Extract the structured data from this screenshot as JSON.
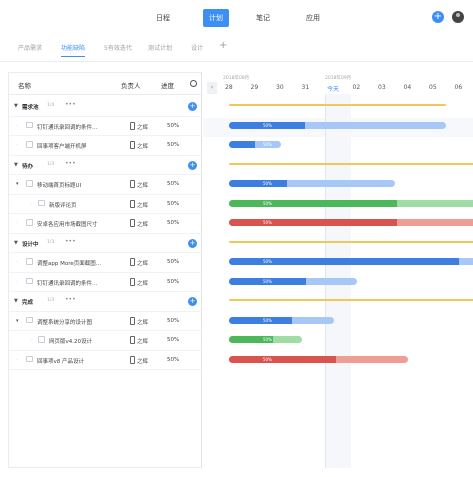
{
  "topnav": {
    "items": [
      {
        "label": "日程",
        "active": false
      },
      {
        "label": "计划",
        "active": true
      },
      {
        "label": "笔记",
        "active": false
      },
      {
        "label": "应用",
        "active": false
      }
    ],
    "add_label": "+"
  },
  "tabs": [
    {
      "label": "产品需求",
      "active": false
    },
    {
      "label": "功能缺陷",
      "active": true
    },
    {
      "label": "5有效迭代",
      "active": false
    },
    {
      "label": "测试计划",
      "active": false
    },
    {
      "label": "设计",
      "active": false
    }
  ],
  "tab_add": "+",
  "table": {
    "headers": {
      "name": "名称",
      "owner": "负责人",
      "progress": "进度"
    },
    "rows": [
      {
        "type": "group",
        "name": "需求池",
        "count": "1/4",
        "more": "•••"
      },
      {
        "type": "task",
        "name": "钉钉通讯录回调的条件...",
        "owner": "之辉",
        "progress": "50%"
      },
      {
        "type": "task",
        "name": "回事项客户端开机屏",
        "owner": "之辉",
        "progress": "50%"
      },
      {
        "type": "group",
        "name": "待办",
        "count": "1/3",
        "more": "•••"
      },
      {
        "type": "task",
        "name": "移动端首页标题UI",
        "owner": "之辉",
        "progress": "50%",
        "expand": true
      },
      {
        "type": "subtask",
        "name": "新版评论页",
        "owner": "之辉",
        "progress": "50%"
      },
      {
        "type": "task",
        "name": "安卓各应用市场截图尺寸",
        "owner": "之辉",
        "progress": "50%"
      },
      {
        "type": "group",
        "name": "设计中",
        "count": "1/3",
        "more": "•••"
      },
      {
        "type": "task",
        "name": "调整app More页面截图...",
        "owner": "之辉",
        "progress": "50%"
      },
      {
        "type": "task",
        "name": "钉钉通讯录回调的条件...",
        "owner": "之辉",
        "progress": "50%"
      },
      {
        "type": "group",
        "name": "完成",
        "count": "1/3",
        "more": "•••"
      },
      {
        "type": "task",
        "name": "调整系统分享的设计图",
        "owner": "之辉",
        "progress": "50%",
        "expand": true
      },
      {
        "type": "subtask",
        "name": "网页版v4.20设计",
        "owner": "之辉",
        "progress": "50%"
      },
      {
        "type": "task",
        "name": "回事项v8 产品设计",
        "owner": "之辉",
        "progress": "50%"
      }
    ]
  },
  "gantt": {
    "months": [
      {
        "label": "2018年08月",
        "day_index": 0
      },
      {
        "label": "2018年09月",
        "day_index": 4
      }
    ],
    "days": [
      "28",
      "29",
      "30",
      "31",
      "今天",
      "02",
      "03",
      "04",
      "05",
      "06"
    ],
    "today_index": 4,
    "bars": [
      {
        "row": 0,
        "kind": "group",
        "start": 0.0,
        "end": 8.5,
        "color": "#f1c75a"
      },
      {
        "row": 1,
        "kind": "task",
        "start": 0.0,
        "end": 8.5,
        "progress": 0.35,
        "color": "#3d7fe0",
        "light": "#a7c8f6",
        "pct": "50%"
      },
      {
        "row": 2,
        "kind": "task",
        "start": 0.0,
        "end": 2.05,
        "progress": 0.5,
        "color": "#3d7fe0",
        "light": "#a7c8f6",
        "pct": "50%"
      },
      {
        "row": 3,
        "kind": "group",
        "start": 0.0,
        "end": 10.0,
        "color": "#f1c75a"
      },
      {
        "row": 4,
        "kind": "task",
        "start": 0.0,
        "end": 6.5,
        "progress": 0.35,
        "color": "#3d7fe0",
        "light": "#a7c8f6",
        "pct": "50%"
      },
      {
        "row": 5,
        "kind": "task",
        "start": 0.0,
        "end": 10.0,
        "progress": 0.66,
        "color": "#4cb85b",
        "light": "#9fdca6",
        "pct": "50%"
      },
      {
        "row": 6,
        "kind": "task",
        "start": 0.0,
        "end": 10.0,
        "progress": 0.66,
        "color": "#d9534f",
        "light": "#ef9e96",
        "pct": "50%"
      },
      {
        "row": 7,
        "kind": "group",
        "start": 0.0,
        "end": 10.0,
        "color": "#f1c75a"
      },
      {
        "row": 8,
        "kind": "task",
        "start": 0.0,
        "end": 10.0,
        "progress": 0.9,
        "color": "#3d7fe0",
        "light": "#a7c8f6",
        "pct": "50%"
      },
      {
        "row": 9,
        "kind": "task",
        "start": 0.0,
        "end": 5.0,
        "progress": 0.6,
        "color": "#3d7fe0",
        "light": "#a7c8f6",
        "pct": "50%"
      },
      {
        "row": 10,
        "kind": "group",
        "start": 0.0,
        "end": 10.0,
        "color": "#f1c75a"
      },
      {
        "row": 11,
        "kind": "task",
        "start": 0.0,
        "end": 4.1,
        "progress": 0.6,
        "color": "#3d7fe0",
        "light": "#a7c8f6",
        "pct": "50%"
      },
      {
        "row": 12,
        "kind": "task",
        "start": 0.0,
        "end": 2.85,
        "progress": 0.6,
        "color": "#4cb85b",
        "light": "#9fdca6",
        "pct": "50%"
      },
      {
        "row": 13,
        "kind": "task",
        "start": 0.0,
        "end": 7.0,
        "progress": 0.6,
        "color": "#d9534f",
        "light": "#ef9e96",
        "pct": "50%"
      }
    ]
  },
  "colors": {
    "accent": "#3d8ff6",
    "group_bar": "#f1c75a"
  }
}
